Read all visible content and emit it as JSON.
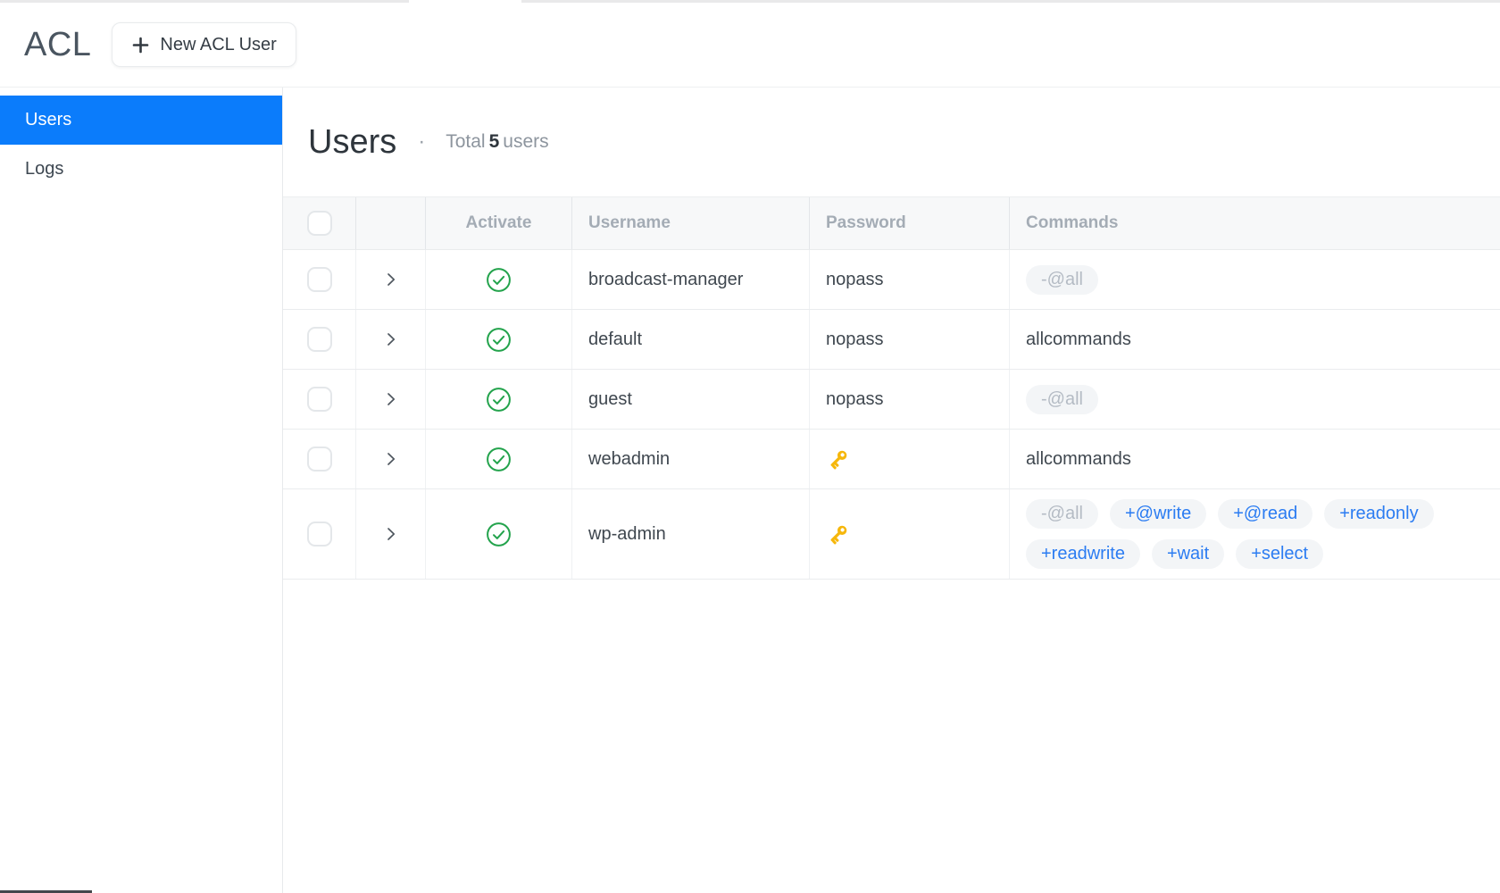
{
  "topbar": {
    "title": "ACL",
    "new_user_button": "New ACL User"
  },
  "sidebar": {
    "items": [
      {
        "label": "Users",
        "active": true
      },
      {
        "label": "Logs",
        "active": false
      }
    ]
  },
  "heading": {
    "title": "Users",
    "separator": "·",
    "total_label": "Total",
    "total_count": "5",
    "total_units": "users"
  },
  "table": {
    "header": {
      "activate": "Activate",
      "username": "Username",
      "password": "Password",
      "commands": "Commands"
    },
    "rows": [
      {
        "username": "broadcast-manager",
        "active": true,
        "password": {
          "type": "text",
          "value": "nopass"
        },
        "commands": [
          {
            "label": "-@all",
            "style": "muted"
          }
        ]
      },
      {
        "username": "default",
        "active": true,
        "password": {
          "type": "text",
          "value": "nopass"
        },
        "commands": [
          {
            "label": "allcommands",
            "style": "plain"
          }
        ]
      },
      {
        "username": "guest",
        "active": true,
        "password": {
          "type": "text",
          "value": "nopass"
        },
        "commands": [
          {
            "label": "-@all",
            "style": "muted"
          }
        ]
      },
      {
        "username": "webadmin",
        "active": true,
        "password": {
          "type": "key",
          "value": ""
        },
        "commands": [
          {
            "label": "allcommands",
            "style": "plain"
          }
        ]
      },
      {
        "username": "wp-admin",
        "active": true,
        "password": {
          "type": "key",
          "value": ""
        },
        "commands": [
          {
            "label": "-@all",
            "style": "muted"
          },
          {
            "label": "+@write",
            "style": "rule"
          },
          {
            "label": "+@read",
            "style": "rule"
          },
          {
            "label": "+readonly",
            "style": "rule"
          },
          {
            "label": "+readwrite",
            "style": "rule"
          },
          {
            "label": "+wait",
            "style": "rule"
          },
          {
            "label": "+select",
            "style": "rule"
          }
        ]
      }
    ]
  },
  "colors": {
    "accent_blue": "#0b7cfb",
    "rule_chip_text": "#2b7cf2",
    "muted_chip_text": "#b4bbc4",
    "active_green": "#23a34c",
    "key_amber": "#f6b70b"
  }
}
